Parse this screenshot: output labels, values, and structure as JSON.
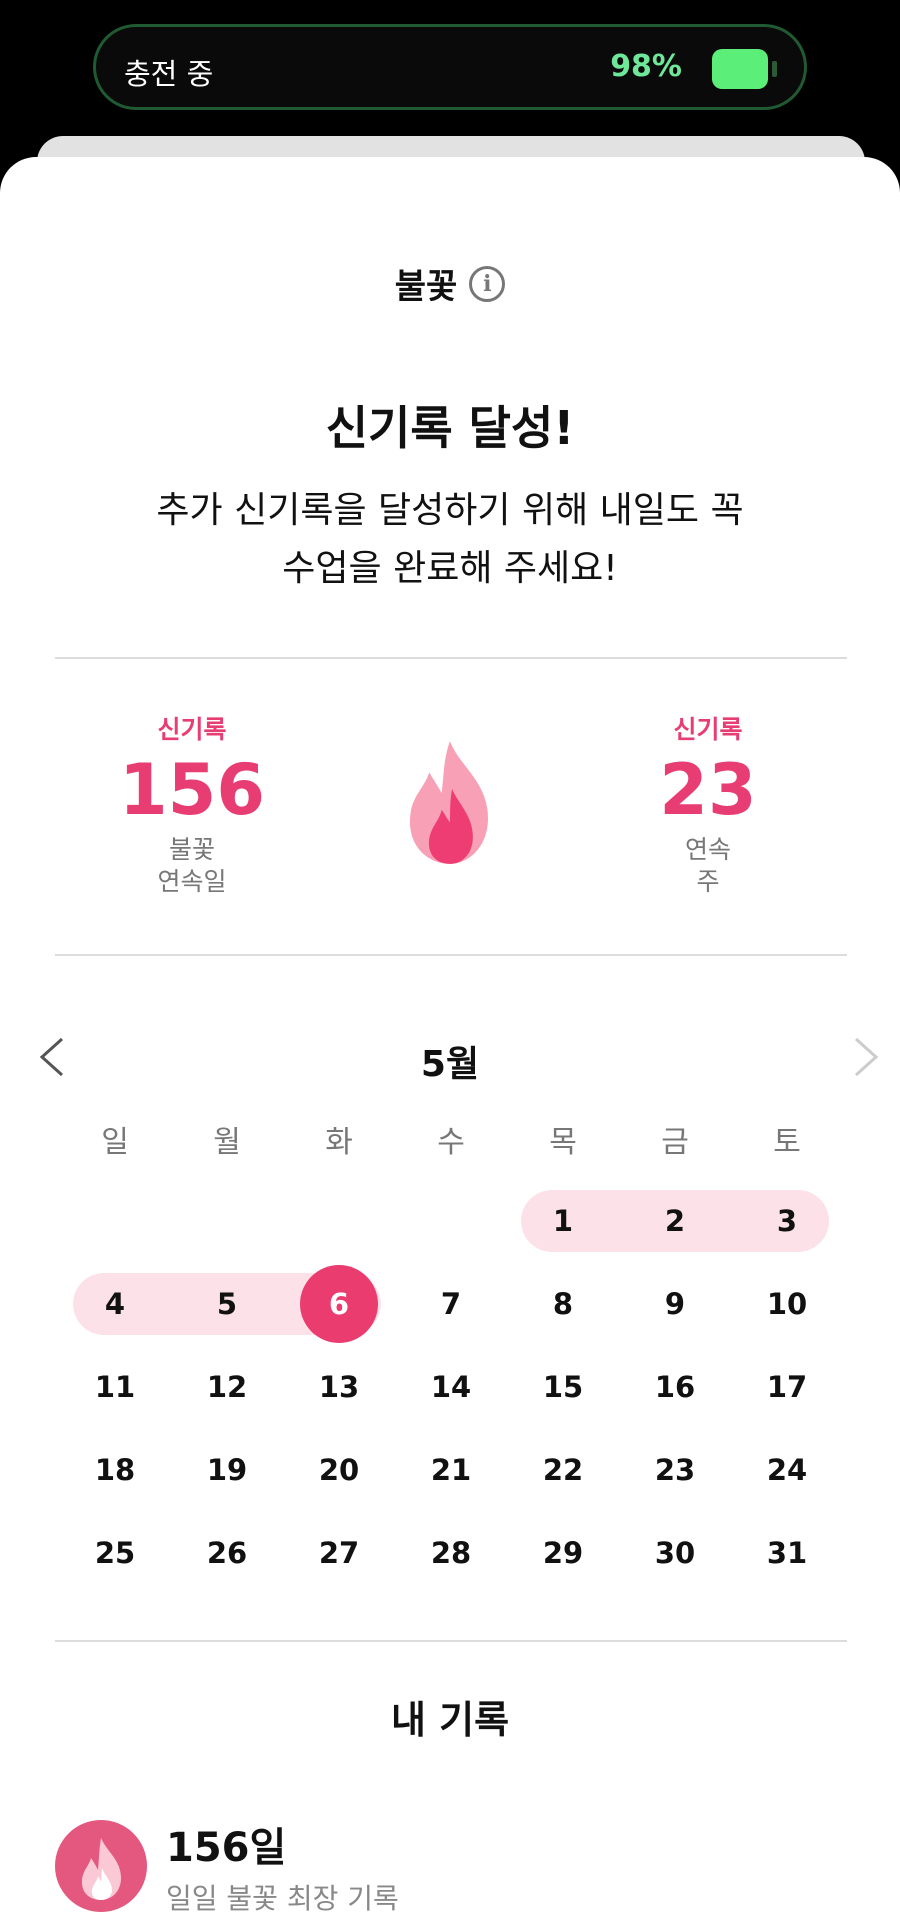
{
  "status": {
    "charging_text": "충전 중",
    "battery_percent": "98%",
    "battery_level": 0.98,
    "battery_color": "#5bee78"
  },
  "header": {
    "title": "불꽃",
    "info_icon": "info-circle-icon"
  },
  "headline": "신기록 달성!",
  "subtext": {
    "line1": "추가 신기록을 달성하기 위해 내일도 꼭",
    "line2": "수업을 완료해 주세요!"
  },
  "stats": {
    "left": {
      "tag": "신기록",
      "value": "156",
      "label_line1": "불꽃",
      "label_line2": "연속일"
    },
    "right": {
      "tag": "신기록",
      "value": "23",
      "label_line1": "연속",
      "label_line2": "주"
    },
    "accent_color": "#e83d72"
  },
  "calendar": {
    "month": "5월",
    "weekdays": [
      "일",
      "월",
      "화",
      "수",
      "목",
      "금",
      "토"
    ],
    "today": 6,
    "first_weekday_index": 4,
    "days_in_month": 31,
    "streak_days": [
      1,
      2,
      3,
      4,
      5,
      6
    ]
  },
  "records": {
    "title": "내 기록",
    "items": [
      {
        "value": "156일",
        "label": "일일 불꽃 최장 기록"
      }
    ]
  }
}
